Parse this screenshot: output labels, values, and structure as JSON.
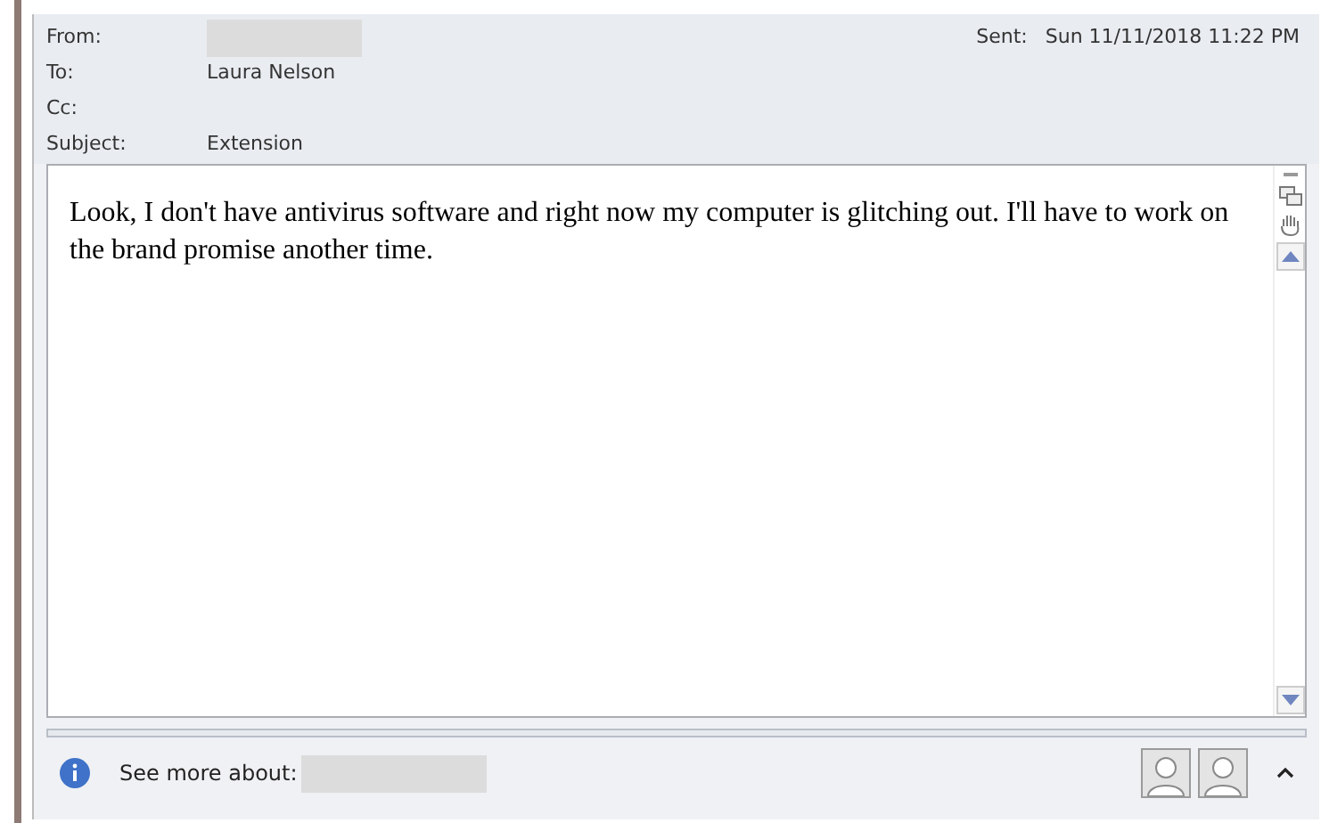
{
  "header": {
    "fields": [
      {
        "label": "From:"
      },
      {
        "label": "To:",
        "value": "Laura Nelson"
      },
      {
        "label": "Cc:"
      },
      {
        "label": "Subject:",
        "value": "Extension"
      }
    ],
    "sent_label": "Sent:",
    "sent_value": "Sun 11/11/2018 11:22 PM"
  },
  "body": "Look, I don't have antivirus software and right now my computer is glitching out. I'll have to work on the brand promise another time.",
  "people_pane": {
    "label": "See more about:"
  }
}
